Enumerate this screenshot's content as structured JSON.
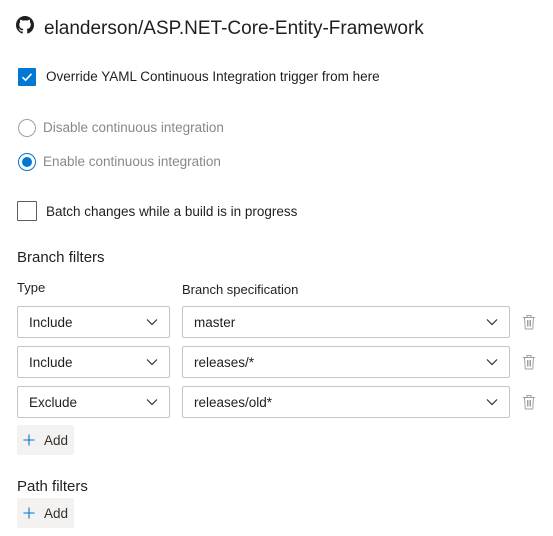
{
  "header": {
    "repo_icon": "github-icon",
    "repo_name": "elanderson/ASP.NET-Core-Entity-Framework"
  },
  "override": {
    "checked": true,
    "label": "Override YAML Continuous Integration trigger from here"
  },
  "ci_options": [
    {
      "label": "Disable continuous integration",
      "selected": false
    },
    {
      "label": "Enable continuous integration",
      "selected": true
    }
  ],
  "batch": {
    "checked": false,
    "label": "Batch changes while a build is in progress"
  },
  "branch_filters": {
    "title": "Branch filters",
    "type_header": "Type",
    "spec_header": "Branch specification",
    "rows": [
      {
        "type": "Include",
        "spec": "master"
      },
      {
        "type": "Include",
        "spec": "releases/*"
      },
      {
        "type": "Exclude",
        "spec": "releases/old*"
      }
    ],
    "add_label": "Add"
  },
  "path_filters": {
    "title": "Path filters",
    "add_label": "Add"
  },
  "colors": {
    "accent": "#0078d4",
    "muted_text": "#8a8886",
    "border": "#c8c6c4",
    "button_bg": "#f3f2f1"
  }
}
